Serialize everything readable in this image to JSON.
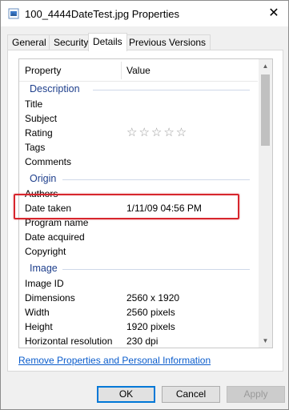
{
  "window": {
    "title": "100_4444DateTest.jpg Properties",
    "close_glyph": "✕",
    "icon": "image-file-icon"
  },
  "tabs": [
    {
      "label": "General",
      "active": false
    },
    {
      "label": "Security",
      "active": false
    },
    {
      "label": "Details",
      "active": true
    },
    {
      "label": "Previous Versions",
      "active": false
    }
  ],
  "columns": {
    "property": "Property",
    "value": "Value"
  },
  "groups": {
    "description": "Description",
    "origin": "Origin",
    "image": "Image"
  },
  "rows": {
    "title": {
      "name": "Title",
      "value": ""
    },
    "subject": {
      "name": "Subject",
      "value": ""
    },
    "rating": {
      "name": "Rating",
      "value": "☆☆☆☆☆"
    },
    "tags": {
      "name": "Tags",
      "value": ""
    },
    "comments": {
      "name": "Comments",
      "value": ""
    },
    "authors": {
      "name": "Authors",
      "value": ""
    },
    "date_taken": {
      "name": "Date taken",
      "value": "1/11/09 04:56 PM"
    },
    "program_name": {
      "name": "Program name",
      "value": ""
    },
    "date_acquired": {
      "name": "Date acquired",
      "value": ""
    },
    "copyright": {
      "name": "Copyright",
      "value": ""
    },
    "image_id": {
      "name": "Image ID",
      "value": ""
    },
    "dimensions": {
      "name": "Dimensions",
      "value": "2560 x 1920"
    },
    "width": {
      "name": "Width",
      "value": "2560 pixels"
    },
    "height": {
      "name": "Height",
      "value": "1920 pixels"
    },
    "horizontal_resolution": {
      "name": "Horizontal resolution",
      "value": "230 dpi"
    }
  },
  "link": {
    "remove": "Remove Properties and Personal Information"
  },
  "buttons": {
    "ok": "OK",
    "cancel": "Cancel",
    "apply": "Apply"
  },
  "colors": {
    "highlight": "#d7262d",
    "group_text": "#1e3f8c",
    "link": "#0a5ccc"
  }
}
